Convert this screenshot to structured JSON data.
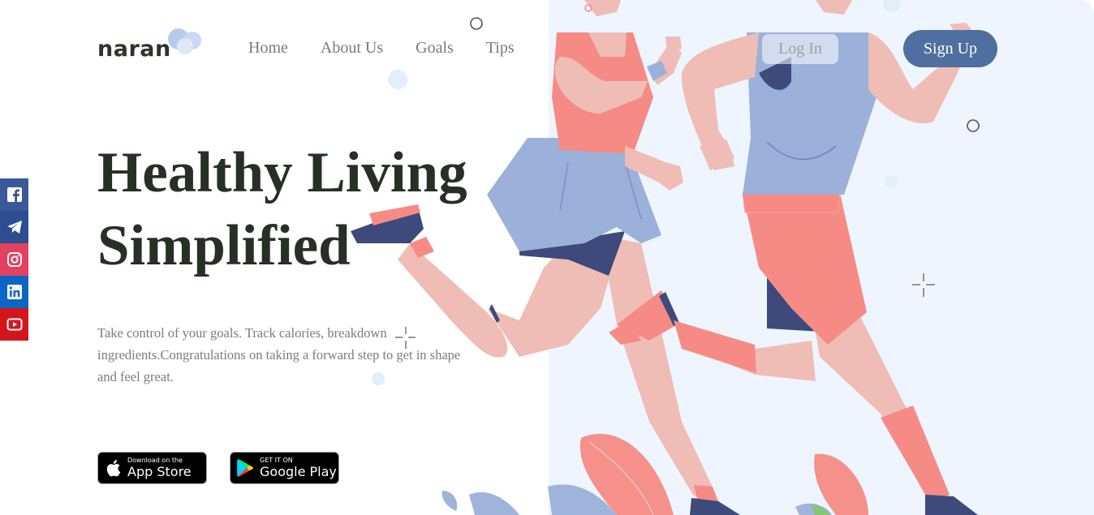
{
  "brand": {
    "name": "naran"
  },
  "nav": {
    "items": [
      {
        "label": "Home"
      },
      {
        "label": "About Us"
      },
      {
        "label": "Goals"
      },
      {
        "label": "Tips"
      }
    ]
  },
  "auth": {
    "login_label": "Log In",
    "signup_label": "Sign Up"
  },
  "hero": {
    "title_line1": "Healthy Living",
    "title_line2": "Simplified",
    "description": "Take control of your goals. Track calories, breakdown ingredients.Congratulations on taking a forward step to get in shape and feel great."
  },
  "apps": {
    "apple": {
      "small": "Download on the",
      "big": "App Store",
      "icon": "apple-icon"
    },
    "google": {
      "small": "GET IT ON",
      "big": "Google Play",
      "icon": "google-play-icon"
    }
  },
  "social": [
    {
      "icon": "facebook-icon",
      "color": "#3b5998"
    },
    {
      "icon": "telegram-icon",
      "color": "#2c4d92"
    },
    {
      "icon": "instagram-icon",
      "color": "#e4405f"
    },
    {
      "icon": "linkedin-icon",
      "color": "#0a66c2"
    },
    {
      "icon": "youtube-icon",
      "color": "#d4161c"
    }
  ],
  "colors": {
    "accent": "#4e6f9f",
    "heading": "#263024",
    "hero_bg": "#eef5fe",
    "skin": "#efbdb5",
    "coral": "#f68b85",
    "blue": "#9bb1d9",
    "navy": "#3d4a7b"
  }
}
